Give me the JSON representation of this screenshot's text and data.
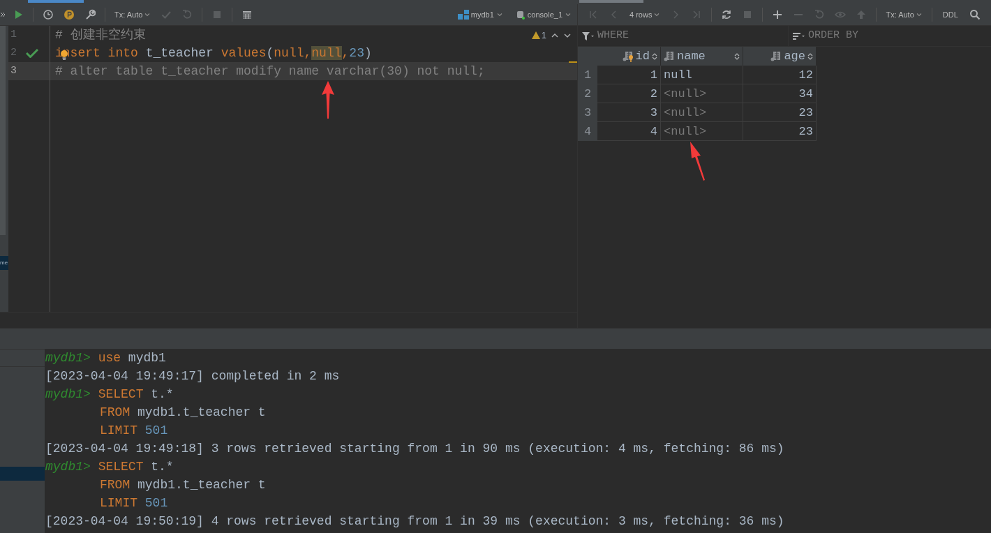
{
  "side_panel": {
    "label": "me"
  },
  "editor_toolbar": [
    {
      "kind": "run",
      "disabled": false
    },
    {
      "kind": "separator"
    },
    {
      "kind": "history",
      "disabled": false
    },
    {
      "kind": "profile",
      "disabled": false
    },
    {
      "kind": "settings",
      "disabled": false
    },
    {
      "kind": "separator"
    },
    {
      "kind": "dropdown",
      "label": "Tx: Auto"
    },
    {
      "kind": "commit",
      "disabled": true
    },
    {
      "kind": "rollback",
      "disabled": true
    },
    {
      "kind": "separator"
    },
    {
      "kind": "stop",
      "disabled": true
    },
    {
      "kind": "separator"
    },
    {
      "kind": "table",
      "disabled": false
    }
  ],
  "datasource": "mydb1",
  "console_name": "console_1",
  "warnings": {
    "count": "1"
  },
  "editor": {
    "lines": [
      {
        "number": "1",
        "executed": false,
        "current": false,
        "tokens": [
          {
            "text": "# 创建非空约束",
            "kind": "comment"
          }
        ]
      },
      {
        "number": "2",
        "executed": true,
        "current": false,
        "tokens": [
          {
            "text": "insert",
            "kind": "keyword"
          },
          {
            "text": " into",
            "kind": "keyword"
          },
          {
            "text": " t_teacher ",
            "kind": "plain"
          },
          {
            "text": "values",
            "kind": "keyword"
          },
          {
            "text": "(",
            "kind": "plain"
          },
          {
            "text": "null,",
            "kind": "keyword"
          },
          {
            "text": "null",
            "kind": "match"
          },
          {
            "text": ",",
            "kind": "keyword"
          },
          {
            "text": "23",
            "kind": "number"
          },
          {
            "text": ")",
            "kind": "plain"
          }
        ]
      },
      {
        "number": "3",
        "executed": false,
        "current": true,
        "tokens": [
          {
            "text": "# alter table t_teacher modify name varchar(30) not null;",
            "kind": "comment"
          }
        ]
      }
    ]
  },
  "result_toolbar": [
    {
      "kind": "first",
      "disabled": true
    },
    {
      "kind": "prev",
      "disabled": true
    },
    {
      "kind": "dropdown",
      "label": "4 rows"
    },
    {
      "kind": "next",
      "disabled": true
    },
    {
      "kind": "last",
      "disabled": true
    },
    {
      "kind": "separator"
    },
    {
      "kind": "refresh",
      "disabled": false
    },
    {
      "kind": "stop",
      "disabled": true
    },
    {
      "kind": "separator"
    },
    {
      "kind": "add",
      "disabled": false
    },
    {
      "kind": "remove",
      "disabled": true
    },
    {
      "kind": "rollback",
      "disabled": true
    },
    {
      "kind": "preview",
      "disabled": true
    },
    {
      "kind": "submit",
      "disabled": true
    },
    {
      "kind": "separator"
    },
    {
      "kind": "dropdown",
      "label": "Tx: Auto"
    },
    {
      "kind": "separator"
    },
    {
      "kind": "text",
      "label": "DDL"
    },
    {
      "kind": "search",
      "disabled": false
    }
  ],
  "filter": {
    "where_placeholder": "WHERE",
    "order_placeholder": "ORDER BY"
  },
  "grid": {
    "columns": [
      {
        "name": "id",
        "key": true,
        "numeric": true
      },
      {
        "name": "name",
        "key": false,
        "numeric": false
      },
      {
        "name": "age",
        "key": false,
        "numeric": true
      }
    ],
    "rows": [
      {
        "number": "1",
        "cells": [
          {
            "text": "1",
            "null": false
          },
          {
            "text": "null",
            "null": false
          },
          {
            "text": "12",
            "null": false
          }
        ]
      },
      {
        "number": "2",
        "cells": [
          {
            "text": "2",
            "null": false
          },
          {
            "text": "<null>",
            "null": true
          },
          {
            "text": "34",
            "null": false
          }
        ]
      },
      {
        "number": "3",
        "cells": [
          {
            "text": "3",
            "null": false
          },
          {
            "text": "<null>",
            "null": true
          },
          {
            "text": "23",
            "null": false
          }
        ]
      },
      {
        "number": "4",
        "cells": [
          {
            "text": "4",
            "null": false
          },
          {
            "text": "<null>",
            "null": true
          },
          {
            "text": "23",
            "null": false
          }
        ]
      }
    ]
  },
  "console": {
    "lines": [
      {
        "kind": "prompt",
        "prompt": "mydb1>",
        "tokens": [
          {
            "text": "use",
            "kind": "keyword"
          },
          {
            "text": " mydb1",
            "kind": "plain"
          }
        ]
      },
      {
        "kind": "log",
        "text": "[2023-04-04 19:49:17] completed in 2 ms"
      },
      {
        "kind": "prompt",
        "prompt": "mydb1>",
        "tokens": [
          {
            "text": "SELECT",
            "kind": "keyword"
          },
          {
            "text": " t.*",
            "kind": "plain"
          }
        ]
      },
      {
        "kind": "continuation",
        "tokens": [
          {
            "text": "FROM",
            "kind": "keyword"
          },
          {
            "text": " mydb1.t_teacher t",
            "kind": "plain"
          }
        ]
      },
      {
        "kind": "continuation",
        "tokens": [
          {
            "text": "LIMIT",
            "kind": "keyword"
          },
          {
            "text": " 501",
            "kind": "number"
          }
        ]
      },
      {
        "kind": "log",
        "text": "[2023-04-04 19:49:18] 3 rows retrieved starting from 1 in 90 ms (execution: 4 ms, fetching: 86 ms)"
      },
      {
        "kind": "prompt",
        "prompt": "mydb1>",
        "tokens": [
          {
            "text": "SELECT",
            "kind": "keyword"
          },
          {
            "text": " t.*",
            "kind": "plain"
          }
        ]
      },
      {
        "kind": "continuation",
        "tokens": [
          {
            "text": "FROM",
            "kind": "keyword"
          },
          {
            "text": " mydb1.t_teacher t",
            "kind": "plain"
          }
        ]
      },
      {
        "kind": "continuation",
        "tokens": [
          {
            "text": "LIMIT",
            "kind": "keyword"
          },
          {
            "text": " 501",
            "kind": "number"
          }
        ]
      },
      {
        "kind": "log",
        "text": "[2023-04-04 19:50:19] 4 rows retrieved starting from 1 in 39 ms (execution: 3 ms, fetching: 36 ms)"
      }
    ]
  }
}
